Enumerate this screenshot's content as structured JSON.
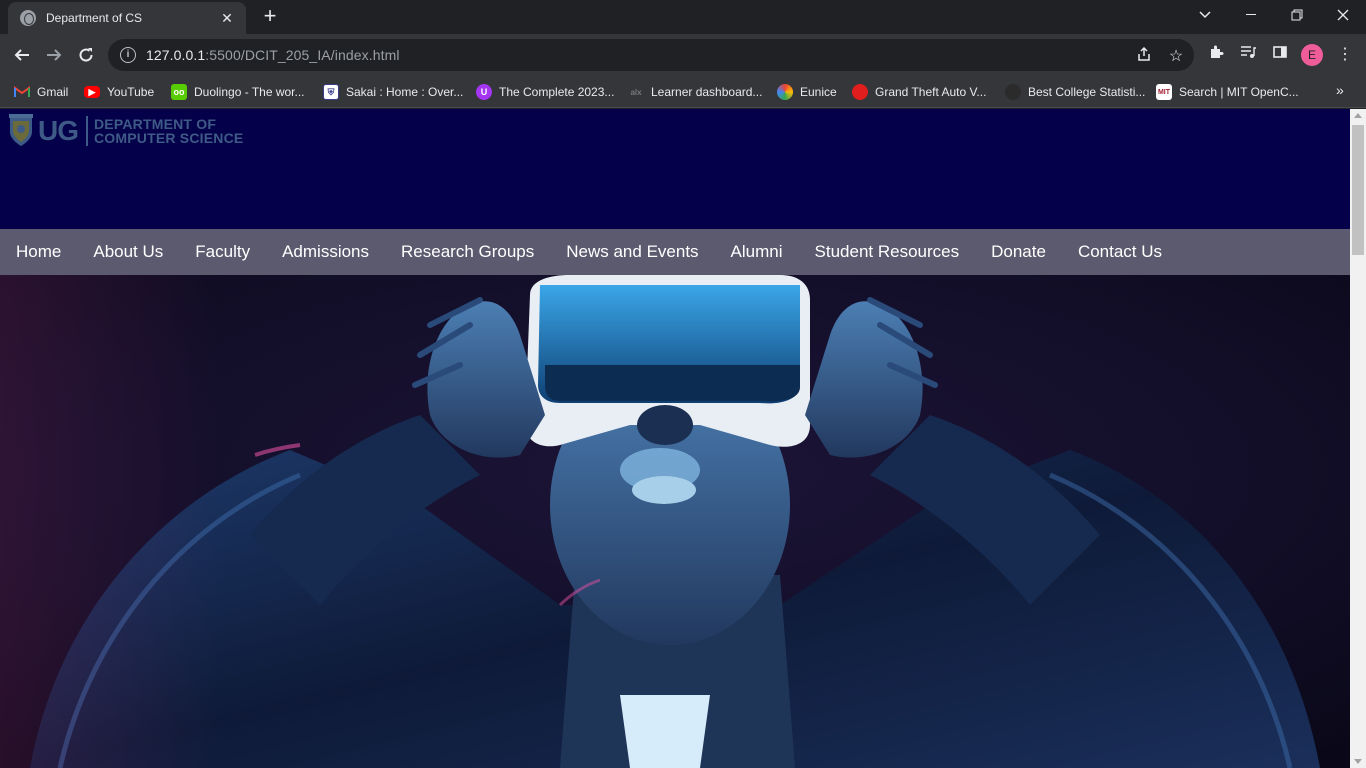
{
  "browser": {
    "tab_title": "Department of CS",
    "url_host": "127.0.0.1",
    "url_rest": ":5500/DCIT_205_IA/index.html",
    "profile_initial": "E"
  },
  "bookmarks": [
    {
      "label": "Gmail",
      "icon": "gmail-icon",
      "color": "#ea4335"
    },
    {
      "label": "YouTube",
      "icon": "youtube-icon",
      "color": "#ff0000"
    },
    {
      "label": "Duolingo - The wor...",
      "icon": "duolingo-icon",
      "color": "#58cc02"
    },
    {
      "label": "Sakai : Home : Over...",
      "icon": "sakai-icon",
      "color": "#3b3b8f"
    },
    {
      "label": "The Complete 2023...",
      "icon": "udemy-icon",
      "color": "#a435f0"
    },
    {
      "label": "Learner dashboard...",
      "icon": "alx-icon",
      "color": "#444444"
    },
    {
      "label": "Eunice",
      "icon": "colorful-icon",
      "color": "#4285f4"
    },
    {
      "label": "Grand Theft Auto V...",
      "icon": "game-icon",
      "color": "#e01e1e"
    },
    {
      "label": "Best College Statisti...",
      "icon": "stats-icon",
      "color": "#2b2b2b"
    },
    {
      "label": "Search | MIT OpenC...",
      "icon": "mit-icon",
      "color": "#a31f34"
    }
  ],
  "site": {
    "logo": {
      "ug": "UG",
      "line1": "DEPARTMENT OF",
      "line2": "COMPUTER SCIENCE"
    },
    "nav": [
      "Home",
      "About Us",
      "Faculty",
      "Admissions",
      "Research Groups",
      "News and Events",
      "Alumni",
      "Student Resources",
      "Donate",
      "Contact Us"
    ]
  },
  "colors": {
    "header_bg": "#05004a",
    "nav_bg": "#5c5a6e",
    "logo_color": "#3e5a86"
  }
}
